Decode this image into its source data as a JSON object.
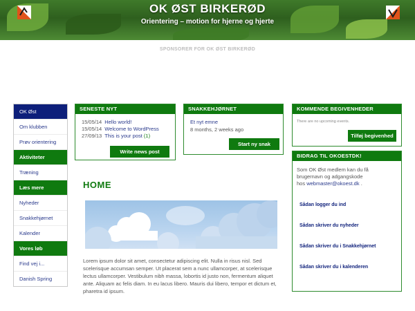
{
  "header": {
    "title": "OK ØST BIRKERØD",
    "subtitle": "Orientering – motion for hjerne og hjerte"
  },
  "sponsor": "SPONSORER FOR OK ØST BIRKERØD",
  "nav": [
    {
      "label": "OK Øst",
      "type": "active"
    },
    {
      "label": "Om klubben",
      "type": "link"
    },
    {
      "label": "Prøv orientering",
      "type": "link"
    },
    {
      "label": "Aktiviteter",
      "type": "section"
    },
    {
      "label": "Træning",
      "type": "link"
    },
    {
      "label": "Læs mere",
      "type": "section"
    },
    {
      "label": "Nyheder",
      "type": "link"
    },
    {
      "label": "Snakkehjørnet",
      "type": "link"
    },
    {
      "label": "Kalender",
      "type": "link"
    },
    {
      "label": "Vores løb",
      "type": "section"
    },
    {
      "label": "Find vej i...",
      "type": "link"
    },
    {
      "label": "Danish Spring",
      "type": "link"
    }
  ],
  "news": {
    "heading": "SENESTE NYT",
    "items": [
      {
        "date": "15/05/14",
        "title": "Hello world!",
        "count": ""
      },
      {
        "date": "15/05/14",
        "title": "Welcome to WordPress",
        "count": ""
      },
      {
        "date": "27/09/13",
        "title": "This is your post",
        "count": "(1)"
      }
    ],
    "button": "Write news post"
  },
  "snak": {
    "heading": "SNAKKEHJØRNET",
    "topic": "Et nyt emne",
    "ago": "8 months, 2 weeks ago",
    "button": "Start ny snak"
  },
  "events": {
    "heading": "KOMMENDE BEGIVENHEDER",
    "empty": "There are no upcoming events.",
    "button": "Tilføj begivenhed"
  },
  "bidrag": {
    "heading": "BIDRAG TIL OKOESTDK!",
    "intro_line1": "Som OK Øst medlem kan du få",
    "intro_line2": "brugernavn og adgangskode",
    "intro_line3_prefix": "hos",
    "email": "webmaster@okoest.dk",
    "intro_line3_suffix": ".",
    "links": [
      "Sådan logger du ind",
      "Sådan skriver du nyheder",
      "Sådan skriver du i Snakkehjørnet",
      "Sådan skriver du i kalenderen"
    ]
  },
  "main": {
    "title": "HOME",
    "body": "Lorem ipsum dolor sit amet, consectetur adipiscing elit. Nulla in risus nisl. Sed scelerisque accumsan semper. Ut placerat sem a nunc ullamcorper, at scelerisque lectus ullamcorper. Vestibulum nibh massa, lobortis id justo non, fermentum aliquet ante. Aliquam ac felis diam. In eu lacus libero. Mauris dui libero, tempor et dictum et, pharetra id ipsum."
  },
  "colors": {
    "green": "#0f7a0f",
    "navy": "#0d1f7a",
    "link": "#2a3a8c"
  }
}
